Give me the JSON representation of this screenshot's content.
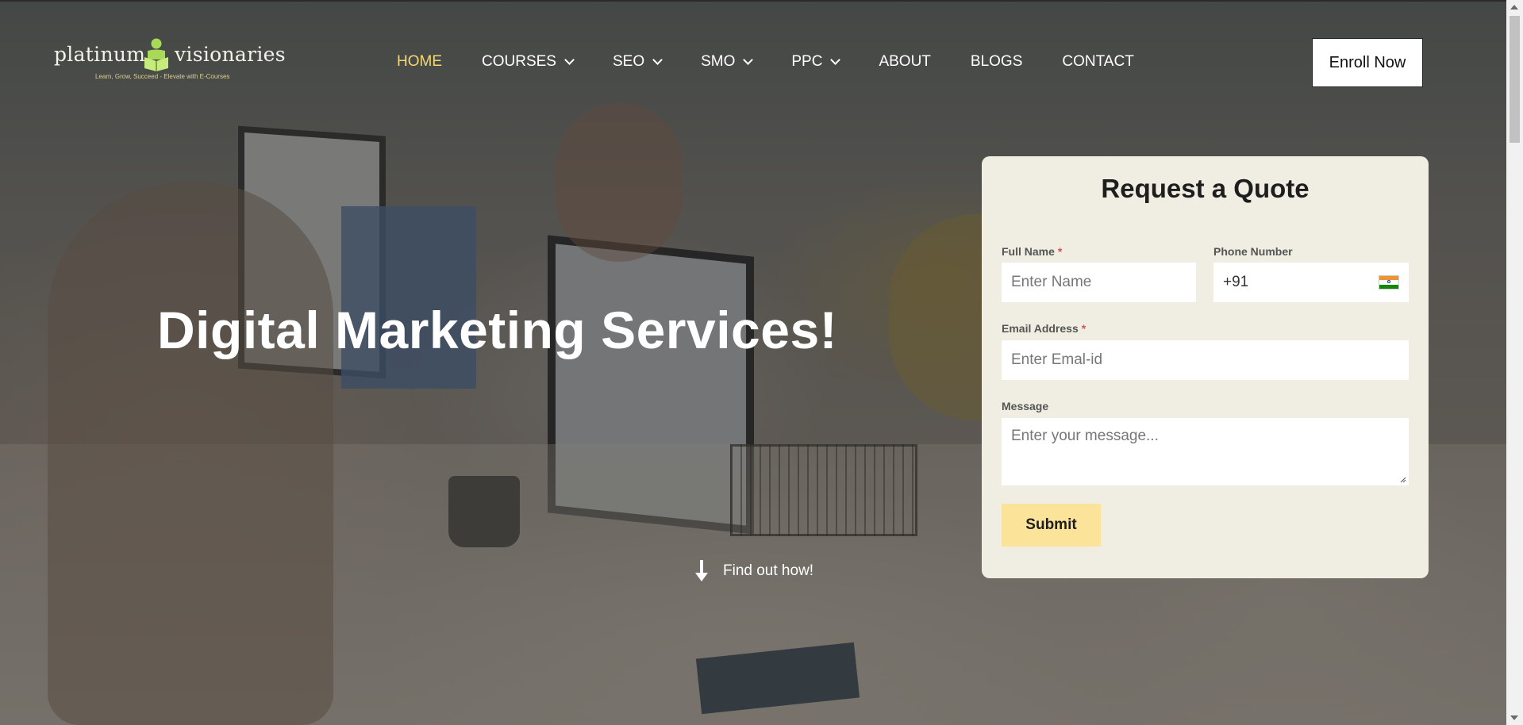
{
  "logo": {
    "left_word": "platinum",
    "right_word": "visionaries",
    "tagline": "Learn, Grow, Succeed - Elevate with E-Courses",
    "mark_icon": "person-reading-icon"
  },
  "nav": {
    "items": [
      {
        "label": "HOME",
        "active": true,
        "dropdown": false
      },
      {
        "label": "COURSES",
        "active": false,
        "dropdown": true
      },
      {
        "label": "SEO",
        "active": false,
        "dropdown": true
      },
      {
        "label": "SMO",
        "active": false,
        "dropdown": true
      },
      {
        "label": "PPC",
        "active": false,
        "dropdown": true
      },
      {
        "label": "ABOUT",
        "active": false,
        "dropdown": false
      },
      {
        "label": "BLOGS",
        "active": false,
        "dropdown": false
      },
      {
        "label": "CONTACT",
        "active": false,
        "dropdown": false
      }
    ],
    "active_color": "#f4d774"
  },
  "header": {
    "enroll_label": "Enroll Now"
  },
  "hero": {
    "title": "Digital Marketing Services!",
    "findout_label": "Find out how!",
    "findout_icon": "arrow-down-icon"
  },
  "quote_form": {
    "title": "Request a Quote",
    "full_name": {
      "label": "Full Name",
      "required_mark": "*",
      "placeholder": "Enter Name",
      "value": ""
    },
    "phone": {
      "label": "Phone Number",
      "value": "+91",
      "flag_icon": "india-flag-icon"
    },
    "email": {
      "label": "Email Address",
      "required_mark": "*",
      "placeholder": "Enter Emal-id",
      "value": ""
    },
    "message": {
      "label": "Message",
      "placeholder": "Enter your message...",
      "value": ""
    },
    "submit_label": "Submit",
    "card_color": "#f0eee2",
    "submit_color": "#fbe39a"
  }
}
